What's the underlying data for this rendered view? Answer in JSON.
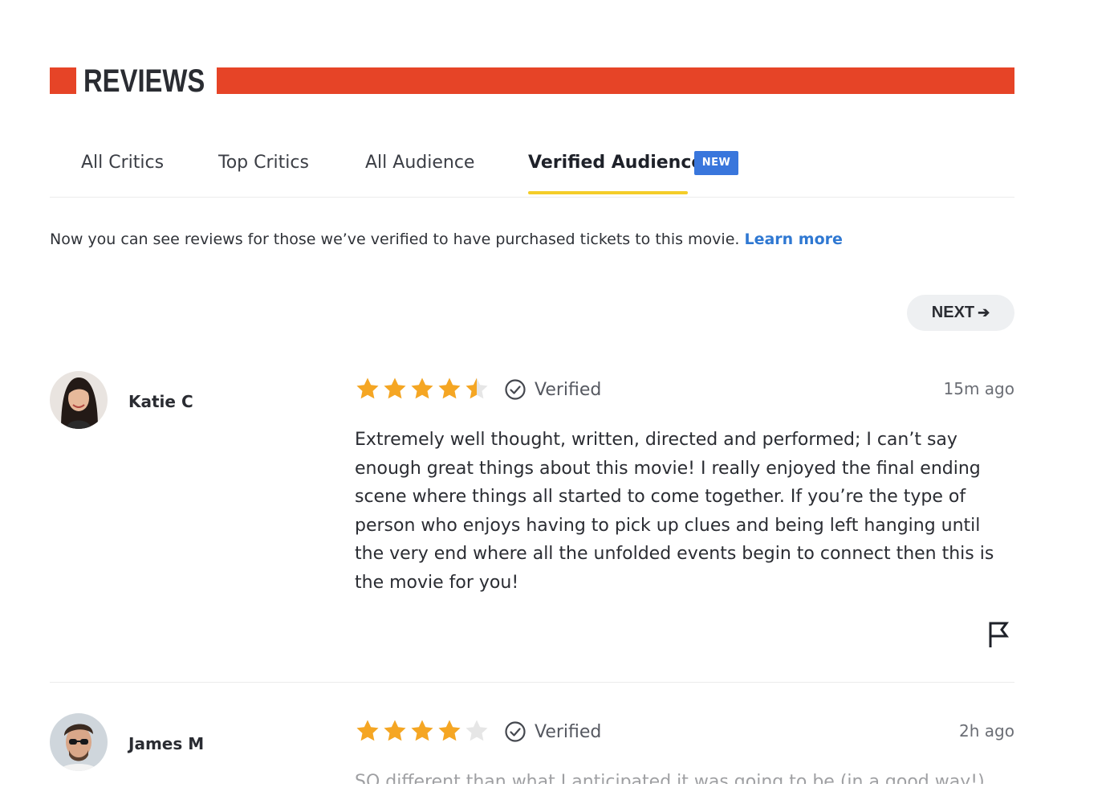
{
  "header": {
    "title": "REVIEWS",
    "accent_color": "#e64427"
  },
  "tabs": [
    {
      "label": "All Critics"
    },
    {
      "label": "Top Critics"
    },
    {
      "label": "All Audience"
    },
    {
      "label": "Verified Audience",
      "badge": "NEW"
    }
  ],
  "active_tab": "Verified Audience",
  "info": {
    "text": "Now you can see reviews for those we’ve verified to have purchased tickets to this movie.",
    "link": "Learn more"
  },
  "pagination": {
    "next_label": "NEXT",
    "next_icon": "arrow-right-icon"
  },
  "reviews": [
    {
      "author": "Katie C",
      "rating": 4.5,
      "max_rating": 5,
      "verified_label": "Verified",
      "time": "15m ago",
      "text": "Extremely well thought, written, directed and performed; I can’t say enough great things about this movie! I really enjoyed the final ending scene where things all started to come together. If you’re the type of person who enjoys having to pick up clues and being left hanging until the very end where all the unfolded events begin to connect then this is the movie for you!",
      "flag_icon": "flag-icon"
    },
    {
      "author": "James M",
      "rating": 4,
      "max_rating": 5,
      "verified_label": "Verified",
      "time": "2h ago",
      "text": "SO different than what I anticipated it was going to be (in a good way!)"
    }
  ],
  "colors": {
    "star": "#f5a623",
    "star_empty": "#e6e6e6",
    "link": "#2f78d2",
    "badge": "#3976dc",
    "tab_underline": "#f4cd28"
  }
}
